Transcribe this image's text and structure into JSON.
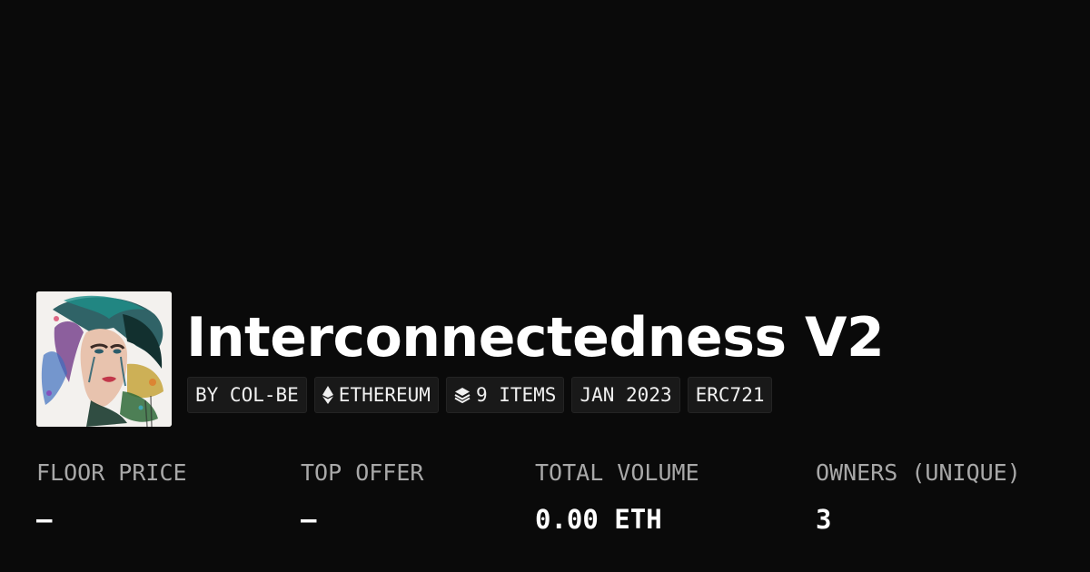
{
  "collection": {
    "title": "Interconnectedness V2",
    "avatar_icon": "collection-artwork-avatar"
  },
  "tags": [
    {
      "label": "BY COL-BE"
    },
    {
      "label": "ETHEREUM",
      "icon": "ethereum-icon"
    },
    {
      "label": "9 ITEMS",
      "icon": "layers-icon"
    },
    {
      "label": "JAN 2023"
    },
    {
      "label": "ERC721"
    }
  ],
  "stats": [
    {
      "label": "FLOOR PRICE",
      "value": "—"
    },
    {
      "label": "TOP OFFER",
      "value": "—"
    },
    {
      "label": "TOTAL VOLUME",
      "value": "0.00 ETH"
    },
    {
      "label": "OWNERS (UNIQUE)",
      "value": "3"
    }
  ],
  "colors": {
    "background": "#0a0a0a",
    "text": "#ffffff",
    "muted": "#a8a8a8",
    "tag_bg": "#191919"
  }
}
